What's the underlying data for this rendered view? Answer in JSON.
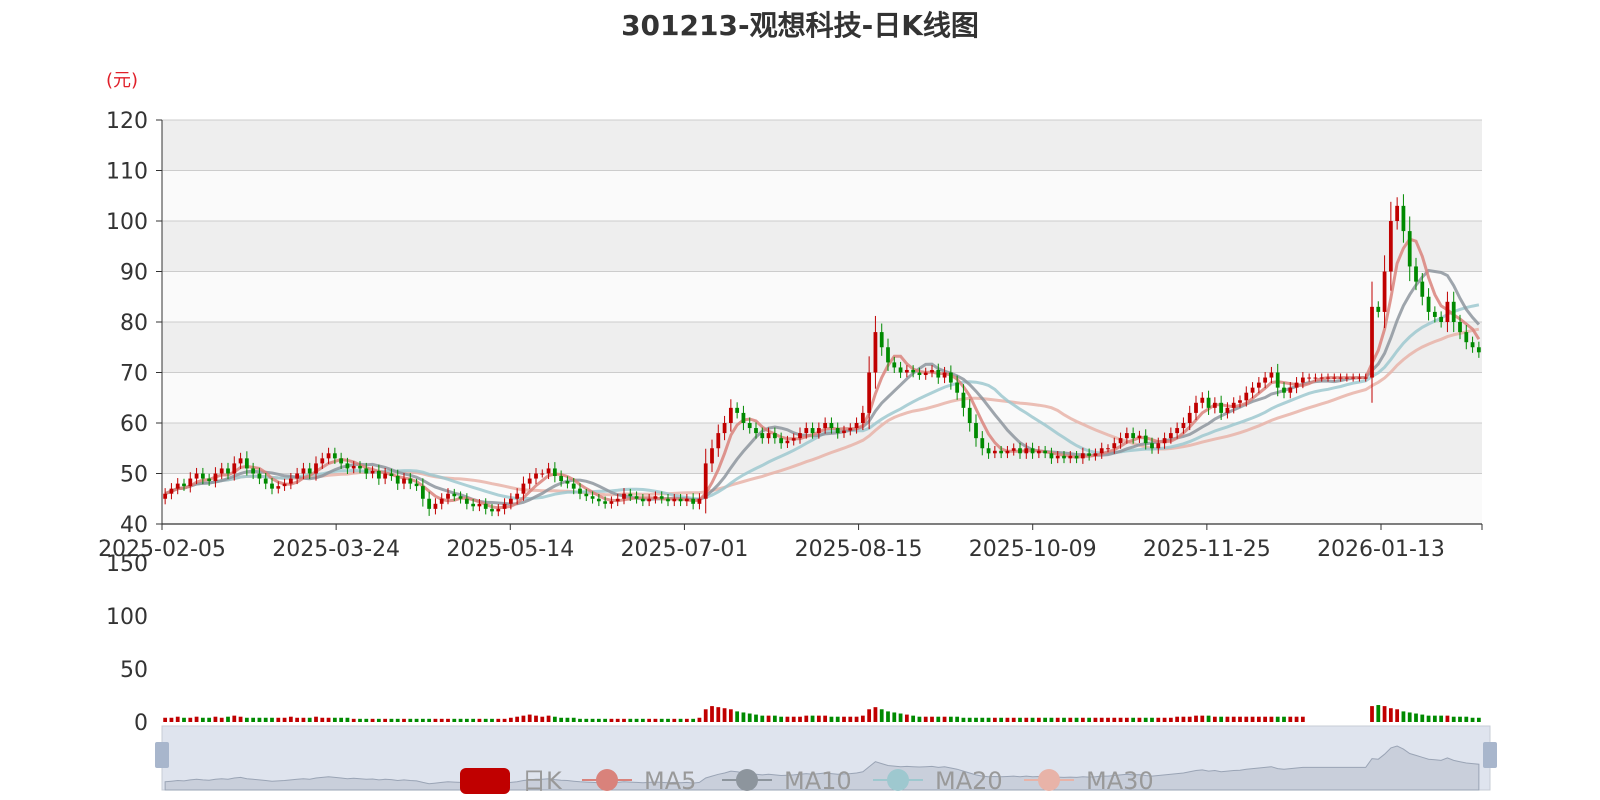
{
  "title": "301213-观想科技-日K线图",
  "colors": {
    "up": "#c00000",
    "down": "#008a00",
    "ma5": "#d9827b",
    "ma10": "#8d959d",
    "ma20": "#9ec8cf",
    "ma30": "#e8b3a8",
    "unit": "#e0202a"
  },
  "chart_data": {
    "type": "candlestick",
    "unit_label": "(元)",
    "price_axis": {
      "min": 40,
      "max": 120,
      "ticks": [
        "40",
        "50",
        "60",
        "70",
        "80",
        "90",
        "100",
        "110",
        "120"
      ]
    },
    "volume_axis": {
      "min": 0,
      "max": 150,
      "ticks": [
        "0",
        "50",
        "100",
        "150"
      ]
    },
    "x_tick_labels": [
      "2025-02-05",
      "2025-03-24",
      "2025-05-14",
      "2025-07-01",
      "2025-08-15",
      "2025-10-09",
      "2025-11-25",
      "2026-01-13"
    ],
    "legend": [
      {
        "name": "日K",
        "icon": "candle-icon"
      },
      {
        "name": "MA5",
        "icon": "ma-line-icon"
      },
      {
        "name": "MA10",
        "icon": "ma-line-icon"
      },
      {
        "name": "MA20",
        "icon": "ma-line-icon"
      },
      {
        "name": "MA30",
        "icon": "ma-line-icon"
      }
    ],
    "close_series": [
      46,
      47,
      48,
      47.5,
      49,
      50,
      49,
      48.5,
      50,
      51,
      50,
      52,
      53,
      51,
      50,
      49,
      48,
      47,
      47.5,
      48,
      49,
      50,
      51,
      50,
      52,
      53,
      54,
      53,
      52,
      51,
      51.5,
      51,
      50,
      50.5,
      49,
      50,
      49.5,
      48,
      49,
      48,
      47.5,
      45,
      43,
      44,
      45,
      46,
      45.5,
      45,
      44,
      43.5,
      44,
      43,
      42.5,
      43,
      44,
      45,
      46,
      48,
      49,
      50,
      50,
      51,
      49.5,
      48.5,
      48,
      47,
      46,
      45.5,
      45,
      44.5,
      44,
      44.5,
      45,
      46,
      45.5,
      45,
      44.5,
      45,
      45.5,
      45,
      44.5,
      45,
      44.5,
      45,
      44,
      45,
      52,
      55,
      58,
      60,
      63,
      62,
      60,
      59,
      58,
      57,
      58,
      57,
      56,
      56.5,
      57,
      58,
      59,
      58,
      59,
      60,
      59,
      58,
      58.5,
      59,
      60,
      62,
      70,
      78,
      75,
      72,
      71,
      70,
      70.5,
      70,
      69.5,
      70,
      70.5,
      69,
      70,
      68,
      66,
      63,
      60,
      57,
      55,
      54,
      54.5,
      54,
      54.5,
      55,
      54,
      55,
      54,
      54.5,
      54,
      53,
      53.5,
      53,
      53.5,
      53,
      54,
      53.5,
      54,
      55,
      55,
      56,
      57,
      58,
      57,
      57.5,
      56,
      55,
      56,
      57,
      58,
      59,
      60,
      62,
      64,
      65,
      63,
      64,
      62,
      63,
      64,
      64.5,
      66,
      67,
      68,
      69,
      70,
      67,
      66,
      67,
      68,
      69,
      69,
      69,
      69,
      69,
      69,
      69,
      69,
      69,
      69,
      69,
      83,
      82,
      90,
      100,
      103,
      98,
      91,
      88,
      85,
      82,
      81,
      80,
      84,
      80,
      78,
      76,
      75,
      74
    ],
    "volume_series": [
      4,
      4,
      5,
      4,
      4,
      5,
      4,
      4,
      5,
      4,
      5,
      6,
      5,
      4,
      4,
      4,
      4,
      4,
      4,
      4,
      5,
      4,
      4,
      4,
      5,
      4,
      4,
      4,
      4,
      4,
      3,
      3,
      3,
      3,
      3,
      3,
      3,
      3,
      3,
      3,
      3,
      3,
      3,
      3,
      3,
      3,
      3,
      3,
      3,
      3,
      3,
      3,
      3,
      3,
      3,
      4,
      5,
      6,
      7,
      6,
      5,
      6,
      5,
      4,
      4,
      4,
      3,
      3,
      3,
      3,
      3,
      3,
      3,
      3,
      3,
      3,
      3,
      3,
      3,
      3,
      3,
      3,
      3,
      3,
      3,
      4,
      12,
      15,
      14,
      13,
      12,
      10,
      9,
      8,
      7,
      6,
      6,
      6,
      5,
      5,
      5,
      5,
      6,
      6,
      6,
      6,
      5,
      5,
      5,
      5,
      5,
      6,
      12,
      14,
      12,
      10,
      9,
      8,
      7,
      6,
      5,
      5,
      5,
      5,
      5,
      5,
      5,
      4,
      4,
      4,
      4,
      4,
      4,
      4,
      4,
      4,
      4,
      4,
      4,
      4,
      4,
      4,
      4,
      4,
      4,
      4,
      4,
      4,
      4,
      4,
      4,
      4,
      4,
      4,
      4,
      4,
      4,
      4,
      4,
      4,
      4,
      5,
      5,
      5,
      6,
      6,
      6,
      5,
      5,
      5,
      5,
      5,
      5,
      5,
      5,
      5,
      5,
      5,
      5,
      5,
      5,
      5,
      0,
      0,
      0,
      0,
      0,
      0,
      0,
      0,
      0,
      0,
      15,
      16,
      15,
      13,
      12,
      10,
      9,
      8,
      7,
      6,
      6,
      6,
      6,
      5,
      5,
      5,
      4,
      4
    ]
  }
}
